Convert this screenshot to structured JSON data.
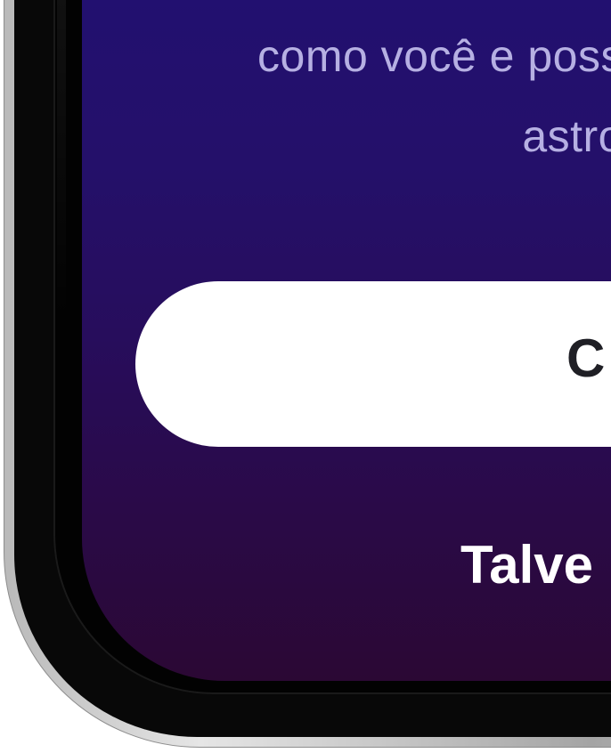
{
  "screen": {
    "subtitle_line1": "como você e poss",
    "subtitle_line2": "astro"
  },
  "cta_button": {
    "label": "C"
  },
  "footer": {
    "link_text": "Talve"
  },
  "colors": {
    "screen_gradient_top": "#221070",
    "screen_gradient_bottom": "#2b0834",
    "subtitle_text": "#b6b0e3",
    "button_background": "#ffffff",
    "button_text": "#1f1f25",
    "footer_text": "#ffffff"
  }
}
